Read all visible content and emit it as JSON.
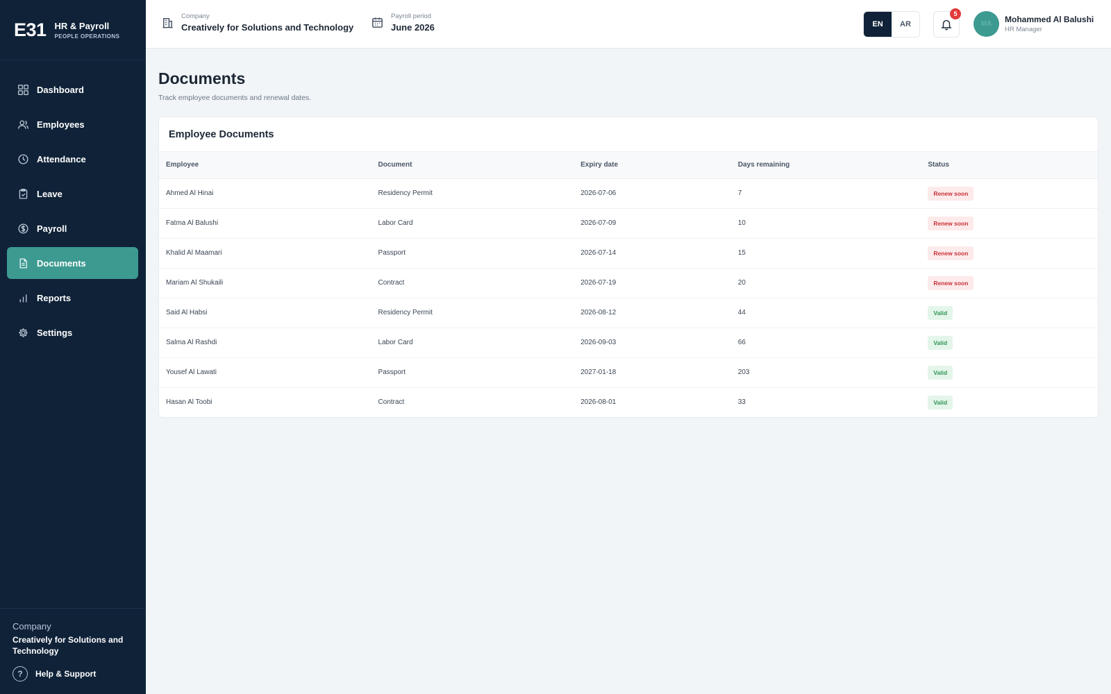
{
  "brand": {
    "logo": "E31",
    "title": "HR & Payroll",
    "subtitle": "PEOPLE OPERATIONS"
  },
  "nav": [
    {
      "label": "Dashboard",
      "icon": "dashboard-icon",
      "active": false
    },
    {
      "label": "Employees",
      "icon": "users-icon",
      "active": false
    },
    {
      "label": "Attendance",
      "icon": "clock-icon",
      "active": false
    },
    {
      "label": "Leave",
      "icon": "clipboard-icon",
      "active": false
    },
    {
      "label": "Payroll",
      "icon": "currency-icon",
      "active": false
    },
    {
      "label": "Documents",
      "icon": "document-icon",
      "active": true
    },
    {
      "label": "Reports",
      "icon": "bar-chart-icon",
      "active": false
    },
    {
      "label": "Settings",
      "icon": "gear-icon",
      "active": false
    }
  ],
  "sidebar_footer": {
    "company_label": "Company",
    "company_name": "Creatively for Solutions and Technology",
    "help_label": "Help & Support"
  },
  "topbar": {
    "company_label": "Company",
    "company_value": "Creatively for Solutions and Technology",
    "period_label": "Payroll period",
    "period_value": "June 2026",
    "lang_en": "EN",
    "lang_ar": "AR",
    "notification_count": "5",
    "user_name": "Mohammed Al Balushi",
    "user_role": "HR Manager",
    "user_initials": "MA"
  },
  "page": {
    "title": "Documents",
    "subtitle": "Track employee documents and renewal dates."
  },
  "table": {
    "title": "Employee Documents",
    "columns": [
      "Employee",
      "Document",
      "Expiry date",
      "Days remaining",
      "Status"
    ],
    "rows": [
      {
        "employee": "Ahmed Al Hinai",
        "document": "Residency Permit",
        "expiry": "2026-07-06",
        "days": "7",
        "status": "Renew soon",
        "status_type": "warn"
      },
      {
        "employee": "Fatma Al Balushi",
        "document": "Labor Card",
        "expiry": "2026-07-09",
        "days": "10",
        "status": "Renew soon",
        "status_type": "warn"
      },
      {
        "employee": "Khalid Al Maamari",
        "document": "Passport",
        "expiry": "2026-07-14",
        "days": "15",
        "status": "Renew soon",
        "status_type": "warn"
      },
      {
        "employee": "Mariam Al Shukaili",
        "document": "Contract",
        "expiry": "2026-07-19",
        "days": "20",
        "status": "Renew soon",
        "status_type": "warn"
      },
      {
        "employee": "Said Al Habsi",
        "document": "Residency Permit",
        "expiry": "2026-08-12",
        "days": "44",
        "status": "Valid",
        "status_type": "ok"
      },
      {
        "employee": "Salma Al Rashdi",
        "document": "Labor Card",
        "expiry": "2026-09-03",
        "days": "66",
        "status": "Valid",
        "status_type": "ok"
      },
      {
        "employee": "Yousef Al Lawati",
        "document": "Passport",
        "expiry": "2027-01-18",
        "days": "203",
        "status": "Valid",
        "status_type": "ok"
      },
      {
        "employee": "Hasan Al Toobi",
        "document": "Contract",
        "expiry": "2026-08-01",
        "days": "33",
        "status": "Valid",
        "status_type": "ok"
      }
    ]
  },
  "colors": {
    "sidebar_bg": "#0f2238",
    "accent": "#3d9a91",
    "warn": "#c8333a",
    "ok": "#2f9553",
    "badge": "#e23b3b"
  }
}
